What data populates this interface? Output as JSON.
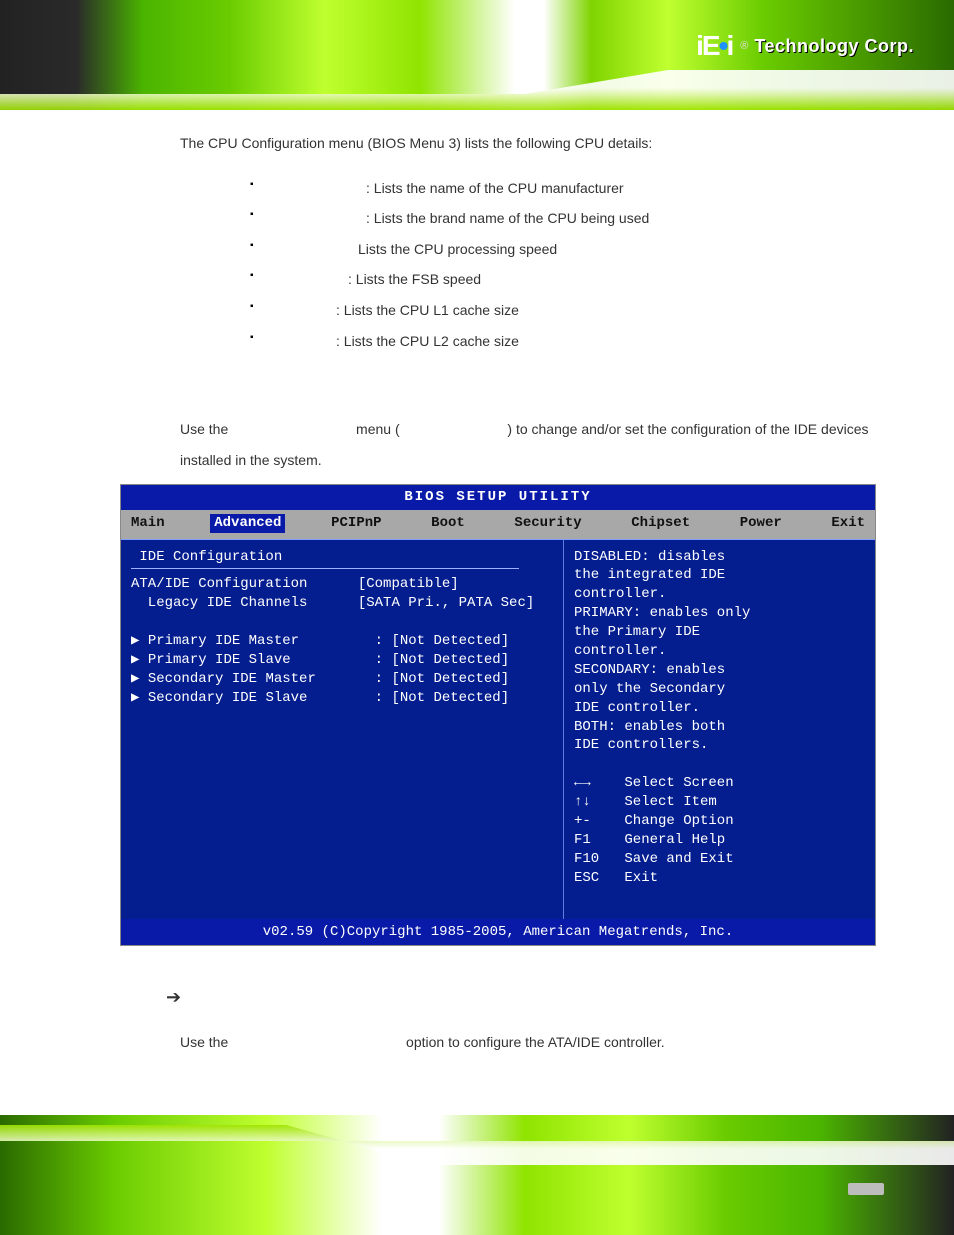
{
  "logo": {
    "mark_prefix": "iE",
    "mark_suffix": "i",
    "registered": "®",
    "text": "Technology Corp."
  },
  "intro": "The CPU Configuration menu (BIOS Menu 3) lists the following CPU details:",
  "details": [
    ": Lists the name of the CPU manufacturer",
    ": Lists the brand name of the CPU being used",
    "Lists the CPU processing speed",
    ": Lists the FSB speed",
    ": Lists the CPU L1 cache size",
    ": Lists the CPU L2 cache size"
  ],
  "para2": {
    "pre": "Use the ",
    "mid": " menu (",
    "post": ") to change and/or set the configuration of the IDE devices installed in the system."
  },
  "bios": {
    "title": "BIOS SETUP UTILITY",
    "menus": [
      "Main",
      "Advanced",
      "PCIPnP",
      "Boot",
      "Security",
      "Chipset",
      "Power",
      "Exit"
    ],
    "active_menu_index": 1,
    "left_heading": "IDE Configuration",
    "settings": [
      {
        "label": "ATA/IDE Configuration",
        "value": "[Compatible]"
      },
      {
        "label": "  Legacy IDE Channels",
        "value": "[SATA Pri., PATA Sec]"
      }
    ],
    "devices": [
      {
        "label": "Primary IDE Master",
        "value": ": [Not Detected]"
      },
      {
        "label": "Primary IDE Slave",
        "value": ": [Not Detected]"
      },
      {
        "label": "Secondary IDE Master",
        "value": ": [Not Detected]"
      },
      {
        "label": "Secondary IDE Slave",
        "value": ": [Not Detected]"
      }
    ],
    "help_text": "DISABLED: disables\nthe integrated IDE\ncontroller.\nPRIMARY: enables only\nthe Primary IDE\ncontroller.\nSECONDARY: enables\nonly the Secondary\nIDE controller.\nBOTH: enables both\nIDE controllers.",
    "nav_help": "←→    Select Screen\n↑↓    Select Item\n+-    Change Option\nF1    General Help\nF10   Save and Exit\nESC   Exit",
    "footer": "v02.59 (C)Copyright 1985-2005, American Megatrends, Inc."
  },
  "arrow": "➔",
  "option": {
    "pre": "Use the ",
    "post": " option to configure the ATA/IDE controller."
  },
  "page_number": ""
}
